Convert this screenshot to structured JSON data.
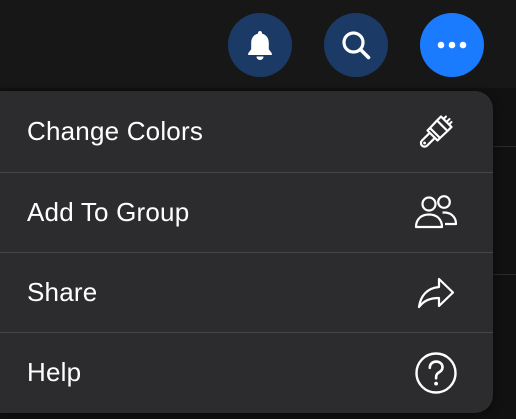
{
  "header": {
    "buttons": [
      {
        "icon": "bell-icon",
        "color": "#1c3a66"
      },
      {
        "icon": "search-icon",
        "color": "#1c3a66"
      },
      {
        "icon": "more-horizontal-icon",
        "color": "#1a7bff"
      }
    ]
  },
  "menu": {
    "items": [
      {
        "label": "Change Colors",
        "icon": "paintbrush-icon"
      },
      {
        "label": "Add To Group",
        "icon": "people-icon"
      },
      {
        "label": "Share",
        "icon": "share-arrow-icon"
      },
      {
        "label": "Help",
        "icon": "question-circle-icon"
      }
    ]
  },
  "colors": {
    "menu_background": "#2c2c2e",
    "accent": "#1a7bff"
  }
}
